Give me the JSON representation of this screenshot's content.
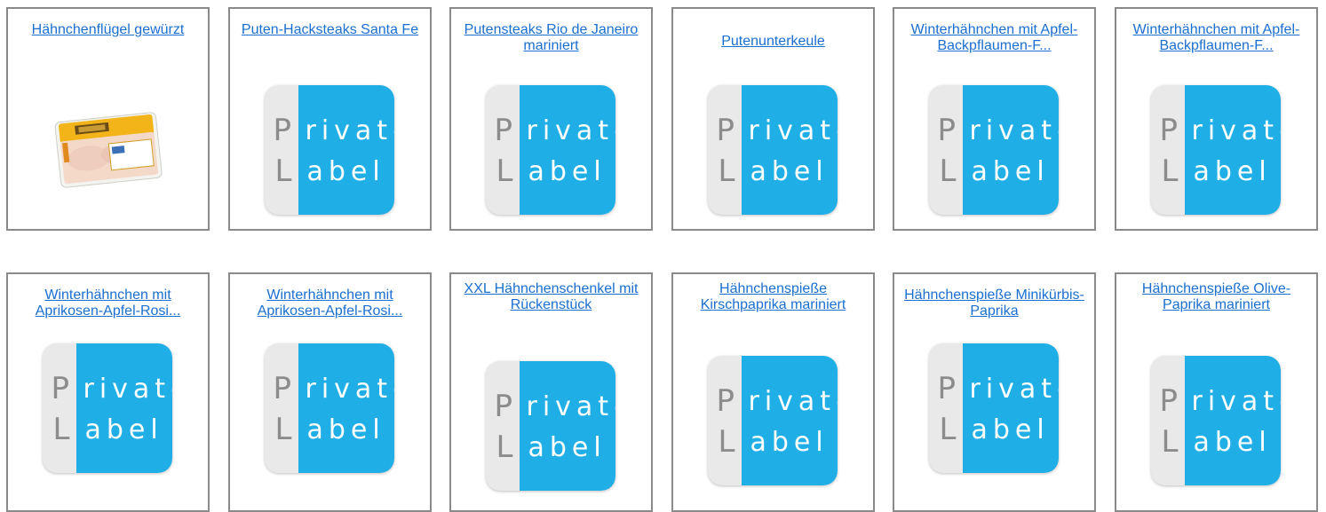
{
  "products": [
    {
      "title": "Hähnchenflügel gewürzt",
      "image": "product-photo"
    },
    {
      "title": "Puten-Hacksteaks Santa Fe",
      "image": "private-label"
    },
    {
      "title": "Putensteaks Rio de Janeiro mariniert",
      "image": "private-label"
    },
    {
      "title": "Putenunterkeule",
      "image": "private-label"
    },
    {
      "title": "Winterhähnchen mit Apfel-Backpflaumen-F...",
      "image": "private-label"
    },
    {
      "title": "Winterhähnchen mit Apfel-Backpflaumen-F...",
      "image": "private-label"
    },
    {
      "title": "Winterhähnchen mit Aprikosen-Apfel-Rosi...",
      "image": "private-label"
    },
    {
      "title": "Winterhähnchen mit Aprikosen-Apfel-Rosi...",
      "image": "private-label"
    },
    {
      "title": "XXL Hähnchenschenkel mit Rückenstück",
      "image": "private-label"
    },
    {
      "title": "Hähnchenspieße Kirschpaprika mariniert",
      "image": "private-label"
    },
    {
      "title": "Hähnchenspieße Minikürbis-Paprika",
      "image": "private-label"
    },
    {
      "title": "Hähnchenspieße Olive-Paprika mariniert",
      "image": "private-label"
    }
  ],
  "private_label": {
    "p": "P",
    "rivate": "rivate",
    "l": "L",
    "abel": "abel"
  },
  "colors": {
    "link": "#1a6fd0",
    "label_blue": "#1faee6",
    "border": "#8a8a8a"
  }
}
